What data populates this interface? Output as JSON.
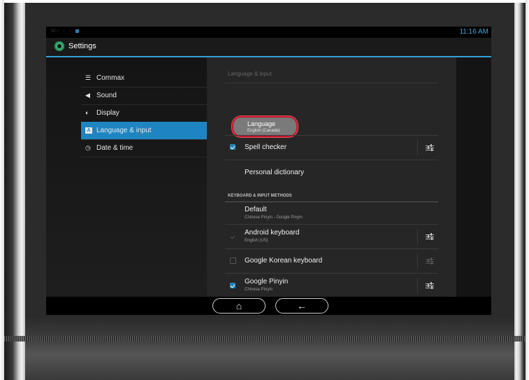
{
  "status_bar": {
    "time": "11:16 AM"
  },
  "action_bar": {
    "title": "Settings",
    "icon": "settings-gear-icon"
  },
  "sidebar": {
    "items": [
      {
        "label": "Commax",
        "icon": "list-icon"
      },
      {
        "label": "Sound",
        "icon": "speaker-icon"
      },
      {
        "label": "Display",
        "icon": "brightness-icon"
      },
      {
        "label": "Language & input",
        "icon": "keyboard-a-icon",
        "selected": true
      },
      {
        "label": "Date & time",
        "icon": "clock-icon"
      }
    ]
  },
  "panel": {
    "title": "Language & input",
    "language": {
      "label": "Language",
      "value": "English (Canada)"
    },
    "spell_checker": {
      "label": "Spell checker",
      "checked": true
    },
    "personal_dictionary": {
      "label": "Personal dictionary"
    },
    "section_header": "KEYBOARD & INPUT METHODS",
    "default": {
      "label": "Default",
      "value": "Chinese Pinyin - Google Pinyin"
    },
    "keyboards": [
      {
        "label": "Android keyboard",
        "sub": "English (US)",
        "state": "checked-disabled"
      },
      {
        "label": "Google Korean keyboard",
        "sub": "",
        "state": "unchecked"
      },
      {
        "label": "Google Pinyin",
        "sub": "Chinese Pinyin",
        "state": "checked"
      }
    ]
  },
  "nav_bar": {
    "home_icon": "home-icon",
    "back_icon": "back-arrow-icon"
  },
  "colors": {
    "accent": "#1f85c2",
    "highlight_ring": "#c0182a",
    "clock": "#4aa3d8"
  }
}
